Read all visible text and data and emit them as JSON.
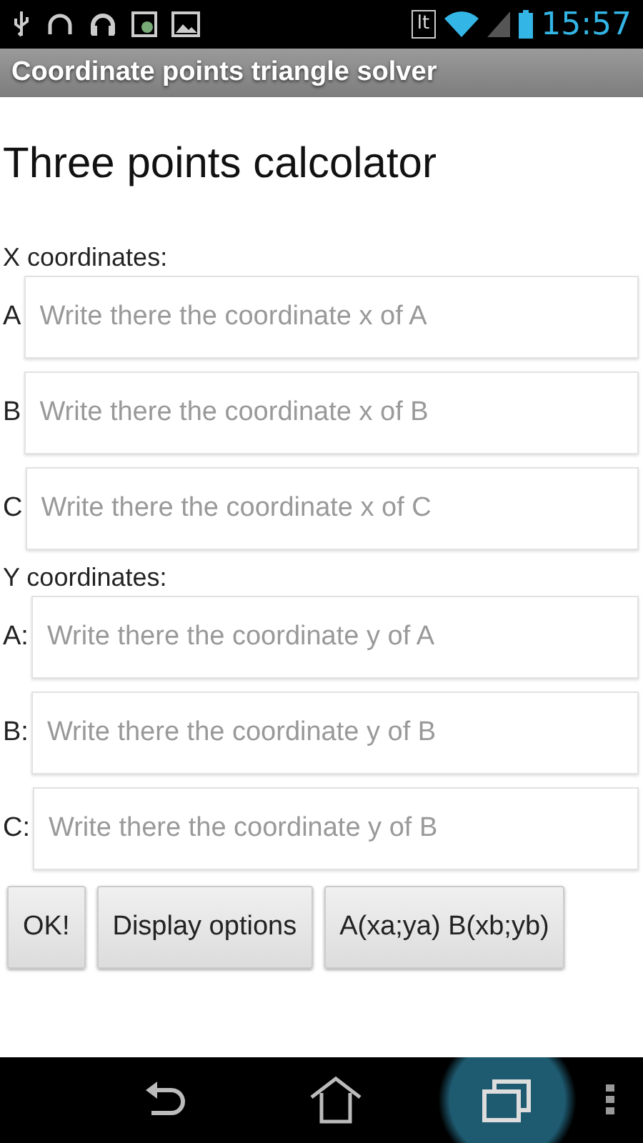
{
  "status_bar": {
    "carrier": "lt",
    "time": "15:57"
  },
  "title_bar": {
    "title": "Coordinate points triangle solver"
  },
  "heading": "Three points calcolator",
  "sections": [
    {
      "label": "X coordinates:",
      "fields": [
        {
          "label": "A",
          "placeholder": "Write there the coordinate x of A"
        },
        {
          "label": "B",
          "placeholder": "Write there the coordinate x of B"
        },
        {
          "label": "C",
          "placeholder": "Write there the coordinate x of C"
        }
      ]
    },
    {
      "label": "Y coordinates:",
      "fields": [
        {
          "label": "A:",
          "placeholder": "Write there the coordinate y of A"
        },
        {
          "label": "B:",
          "placeholder": "Write there the coordinate y of B"
        },
        {
          "label": "C:",
          "placeholder": "Write there the coordinate y of B"
        }
      ]
    }
  ],
  "buttons": [
    "OK!",
    "Display options",
    "A(xa;ya) B(xb;yb)"
  ],
  "nav_buttons": [
    {
      "kind": "back",
      "selected": false
    },
    {
      "kind": "home",
      "selected": false
    },
    {
      "kind": "recent",
      "selected": true
    }
  ]
}
